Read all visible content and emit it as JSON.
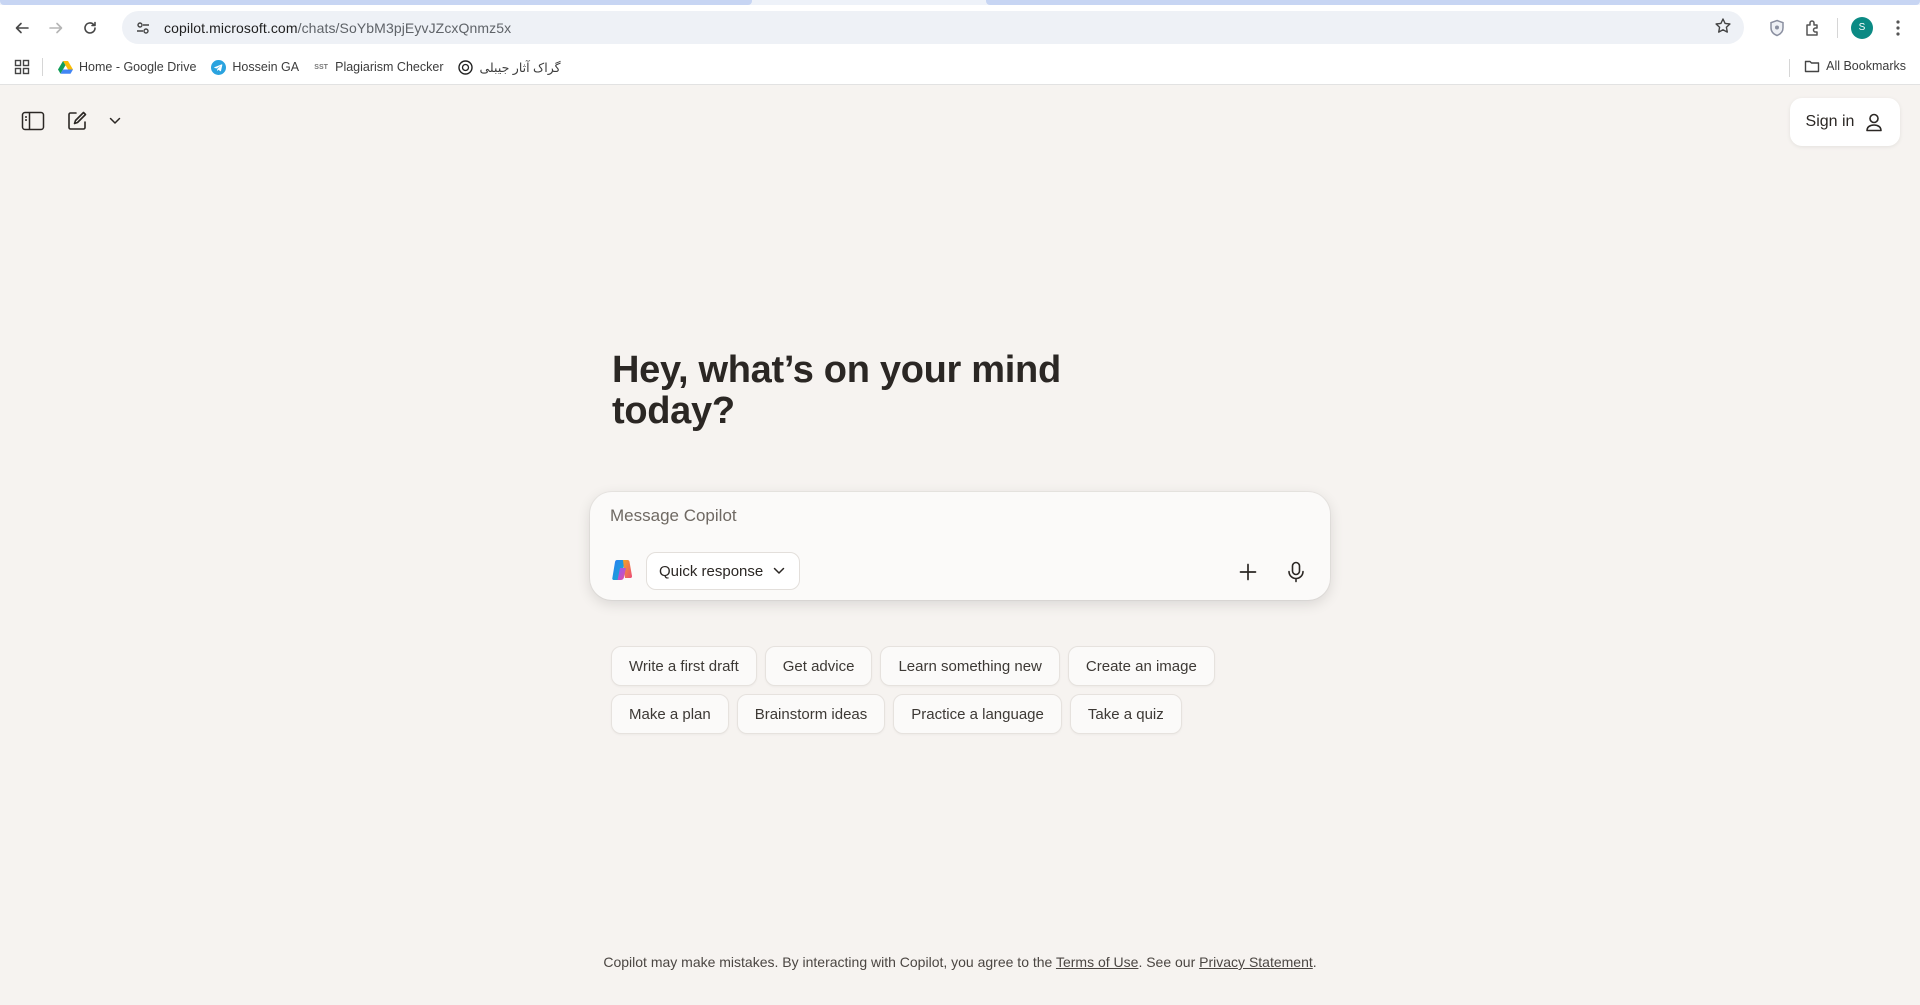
{
  "browser": {
    "url_host": "copilot.microsoft.com",
    "url_path": "/chats/SoYbM3pjEyvJZcxQnmz5x",
    "profile_initial": "S",
    "bookmarks": [
      {
        "label": "Home - Google Drive",
        "icon": "google-drive-icon"
      },
      {
        "label": "Hossein GA",
        "icon": "telegram-icon"
      },
      {
        "label": "Plagiarism Checker",
        "icon": "sst-icon"
      },
      {
        "label": "گراک آثار جیبلی",
        "icon": "openai-icon"
      }
    ],
    "all_bookmarks_label": "All Bookmarks"
  },
  "page": {
    "signin_label": "Sign in",
    "greeting": "Hey, what’s on your mind today?",
    "composer": {
      "placeholder": "Message Copilot",
      "mode_label": "Quick response"
    },
    "suggestions_row1": [
      "Write a first draft",
      "Get advice",
      "Learn something new",
      "Create an image"
    ],
    "suggestions_row2": [
      "Make a plan",
      "Brainstorm ideas",
      "Practice a language",
      "Take a quiz"
    ],
    "footer": {
      "text_before": "Copilot may make mistakes. By interacting with Copilot, you agree to the",
      "terms_link": "Terms of Use",
      "text_middle": ". See our",
      "privacy_link": "Privacy Statement",
      "text_after": "."
    }
  },
  "colors": {
    "page_background": "#f6f3f0",
    "text": "#2b2724",
    "profile": "#0b8a84"
  }
}
